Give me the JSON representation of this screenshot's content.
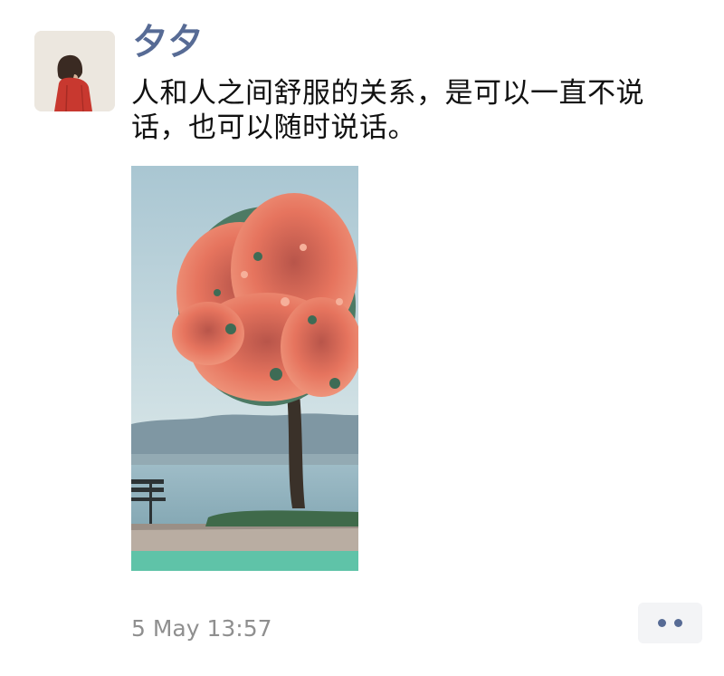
{
  "post": {
    "author_name": "夕夕",
    "text": "人和人之间舒服的关系，是可以一直不说\n话，也可以随时说话。",
    "timestamp": "5 May 13:57"
  },
  "avatar": {
    "icon": "avatar-girl-red-coat",
    "background_color": "#ece7df",
    "coat_color": "#c8382f",
    "hair_color": "#3a2a22"
  },
  "image": {
    "icon": "photo-flowering-tree-by-lake",
    "sky_color": "#b7d1d9",
    "blossom_color": "#e8735f",
    "water_color": "#8fb3c0",
    "grass_color": "#5fc3a8"
  },
  "more_button": {
    "icon": "more-dots-icon",
    "dot_color": "#576b95"
  },
  "colors": {
    "name_link": "#576b95",
    "body_text": "#111111",
    "timestamp_text": "#8f8f8f"
  }
}
